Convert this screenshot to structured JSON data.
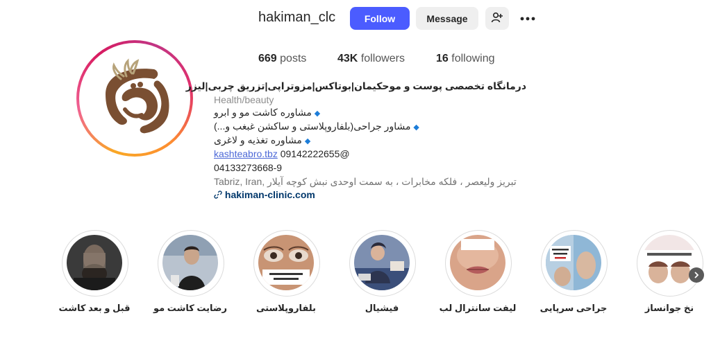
{
  "header": {
    "username": "hakiman_clc",
    "follow_label": "Follow",
    "message_label": "Message",
    "add_user_icon": "person-add-icon",
    "more_icon": "more-horizontal-icon"
  },
  "stats": {
    "posts_count": "669",
    "posts_label": "posts",
    "followers_count": "43K",
    "followers_label": "followers",
    "following_count": "16",
    "following_label": "following"
  },
  "bio": {
    "name": "درمانگاه تخصصی پوست و موحکیمان|بوتاکس|مزوتراپی|تزریق چربی|لیزر",
    "category": "Health/beauty",
    "line1": "مشاوره کاشت مو و ابرو",
    "line2": "مشاور جراحی(بلفاروپلاستی و ساکشن غبغب و...)",
    "line3": "مشاوره تغذیه و لاغری",
    "mention": "kashteabro.tbz",
    "phone1": "09142222655@",
    "phone2": "04133273668-9",
    "address": "تبریز ولیعصر ، فلکه مخابرات ، به سمت اوحدی نبش کوچه آیلار ,Tabriz, Iran",
    "link": "hakiman-clinic.com",
    "link_icon": "link-icon"
  },
  "highlights": [
    {
      "label": "قبل و بعد کاشت",
      "image": "blurred portrait of bearded man"
    },
    {
      "label": "رضایت کاشت مو",
      "image": "young man with dark hair"
    },
    {
      "label": "بلفاروپلاستی",
      "image": "eye close-up before and after"
    },
    {
      "label": "فیشیال",
      "image": "facial treatment session"
    },
    {
      "label": "لیفت سانترال لب",
      "image": "lip lift close-up"
    },
    {
      "label": "جراحی سرپایی",
      "image": "chin surgery before and after"
    },
    {
      "label": "نخ جوانساز",
      "image": "face thread lift before and after"
    }
  ],
  "highlight_next_icon": "chevron-right-icon"
}
